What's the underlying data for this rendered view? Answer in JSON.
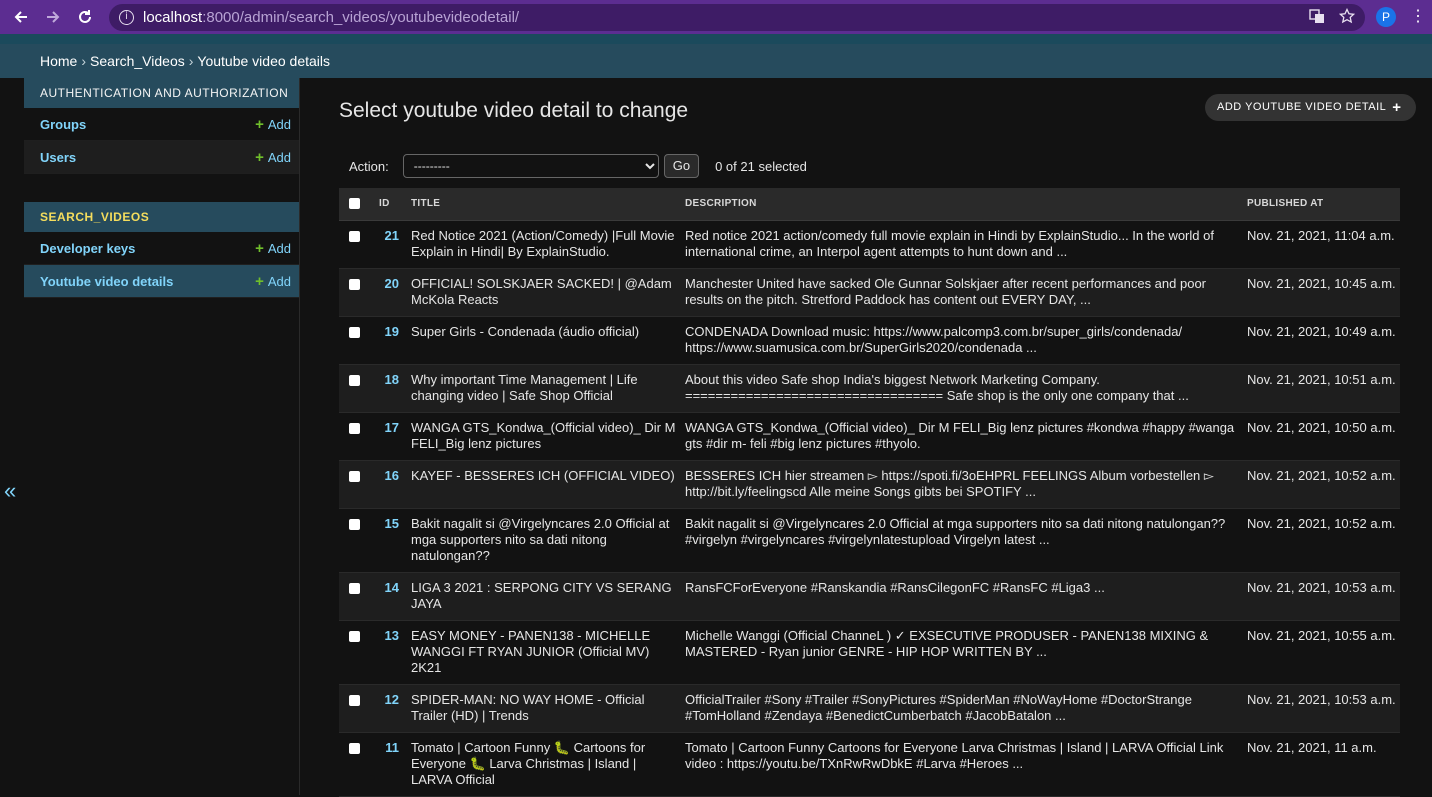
{
  "browser": {
    "url_host": "localhost",
    "url_path": ":8000/admin/search_videos/youtubevideodetail/",
    "profile_initial": "P"
  },
  "breadcrumb": {
    "home": "Home",
    "sep1": "›",
    "app": "Search_Videos",
    "sep2": "›",
    "current": "Youtube video details"
  },
  "sidebar": {
    "apps": [
      {
        "name": "AUTHENTICATION AND AUTHORIZATION",
        "models": [
          {
            "label": "Groups",
            "add": "Add"
          },
          {
            "label": "Users",
            "add": "Add"
          }
        ]
      },
      {
        "name": "SEARCH_VIDEOS",
        "models": [
          {
            "label": "Developer keys",
            "add": "Add"
          },
          {
            "label": "Youtube video details",
            "add": "Add"
          }
        ]
      }
    ],
    "collapse_glyph": "«"
  },
  "main": {
    "title": "Select youtube video detail to change",
    "add_button": "ADD YOUTUBE VIDEO DETAIL",
    "action_label": "Action:",
    "action_selected": "---------",
    "go_label": "Go",
    "selection_count": "0 of 21 selected",
    "columns": [
      "ID",
      "TITLE",
      "DESCRIPTION",
      "PUBLISHED AT"
    ],
    "rows": [
      {
        "id": "21",
        "title": "Red Notice 2021 (Action/Comedy) |Full Movie Explain in Hindi| By ExplainStudio.",
        "description": "Red notice 2021 action/comedy full movie explain in Hindi by ExplainStudio... In the world of international crime, an Interpol agent attempts to hunt down and ...",
        "published": "Nov. 21, 2021, 11:04 a.m."
      },
      {
        "id": "20",
        "title": "OFFICIAL! SOLSKJAER SACKED! | @Adam McKola Reacts",
        "description": "Manchester United have sacked Ole Gunnar Solskjaer after recent performances and poor results on the pitch. Stretford Paddock has content out EVERY DAY, ...",
        "published": "Nov. 21, 2021, 10:45 a.m."
      },
      {
        "id": "19",
        "title": "Super Girls - Condenada (áudio official)",
        "description": "CONDENADA Download music: https://www.palcomp3.com.br/super_girls/condenada/ https://www.suamusica.com.br/SuperGirls2020/condenada ...",
        "published": "Nov. 21, 2021, 10:49 a.m."
      },
      {
        "id": "18",
        "title": "Why important Time Management | Life changing video | Safe Shop Official",
        "description": "About this video Safe shop India's biggest Network Marketing Company. ================================== Safe shop is the only one company that ...",
        "published": "Nov. 21, 2021, 10:51 a.m."
      },
      {
        "id": "17",
        "title": "WANGA GTS_Kondwa_(Official video)_ Dir M FELI_Big lenz pictures",
        "description": "WANGA GTS_Kondwa_(Official video)_ Dir M FELI_Big lenz pictures #kondwa #happy #wanga gts #dir m- feli #big lenz pictures #thyolo.",
        "published": "Nov. 21, 2021, 10:50 a.m."
      },
      {
        "id": "16",
        "title": "KAYEF - BESSERES ICH (OFFICIAL VIDEO)",
        "description": "BESSERES ICH hier streamen ▻ https://spoti.fi/3oEHPRL FEELINGS Album vorbestellen ▻ http://bit.ly/feelingscd Alle meine Songs gibts bei SPOTIFY ...",
        "published": "Nov. 21, 2021, 10:52 a.m."
      },
      {
        "id": "15",
        "title": "Bakit nagalit si @Virgelyncares 2.0 Official at mga supporters nito sa dati nitong natulongan??",
        "description": "Bakit nagalit si @Virgelyncares 2.0 Official at mga supporters nito sa dati nitong natulongan?? #virgelyn #virgelyncares #virgelynlatestupload Virgelyn latest ...",
        "published": "Nov. 21, 2021, 10:52 a.m."
      },
      {
        "id": "14",
        "title": "LIGA 3 2021 : SERPONG CITY VS SERANG JAYA",
        "description": "RansFCForEveryone #Ranskandia #RansCilegonFC #RansFC #Liga3 ...",
        "published": "Nov. 21, 2021, 10:53 a.m."
      },
      {
        "id": "13",
        "title": "EASY MONEY - PANEN138 - MICHELLE WANGGI FT RYAN JUNIOR (Official MV) 2K21",
        "description": "Michelle Wanggi (Official ChanneL ) ✓ EXSECUTIVE PRODUSER - PANEN138 MIXING & MASTERED - Ryan junior GENRE - HIP HOP WRITTEN BY ...",
        "published": "Nov. 21, 2021, 10:55 a.m."
      },
      {
        "id": "12",
        "title": "SPIDER-MAN: NO WAY HOME - Official Trailer (HD) | Trends",
        "description": "OfficialTrailer #Sony #Trailer #SonyPictures #SpiderMan #NoWayHome #DoctorStrange #TomHolland #Zendaya #BenedictCumberbatch #JacobBatalon ...",
        "published": "Nov. 21, 2021, 10:53 a.m."
      },
      {
        "id": "11",
        "title": "Tomato | Cartoon Funny 🐛 Cartoons for Everyone 🐛 Larva Christmas | Island | LARVA Official",
        "description": "Tomato | Cartoon Funny Cartoons for Everyone Larva Christmas | Island | LARVA Official Link video : https://youtu.be/TXnRwRwDbkE #Larva #Heroes ...",
        "published": "Nov. 21, 2021, 11 a.m."
      }
    ]
  }
}
